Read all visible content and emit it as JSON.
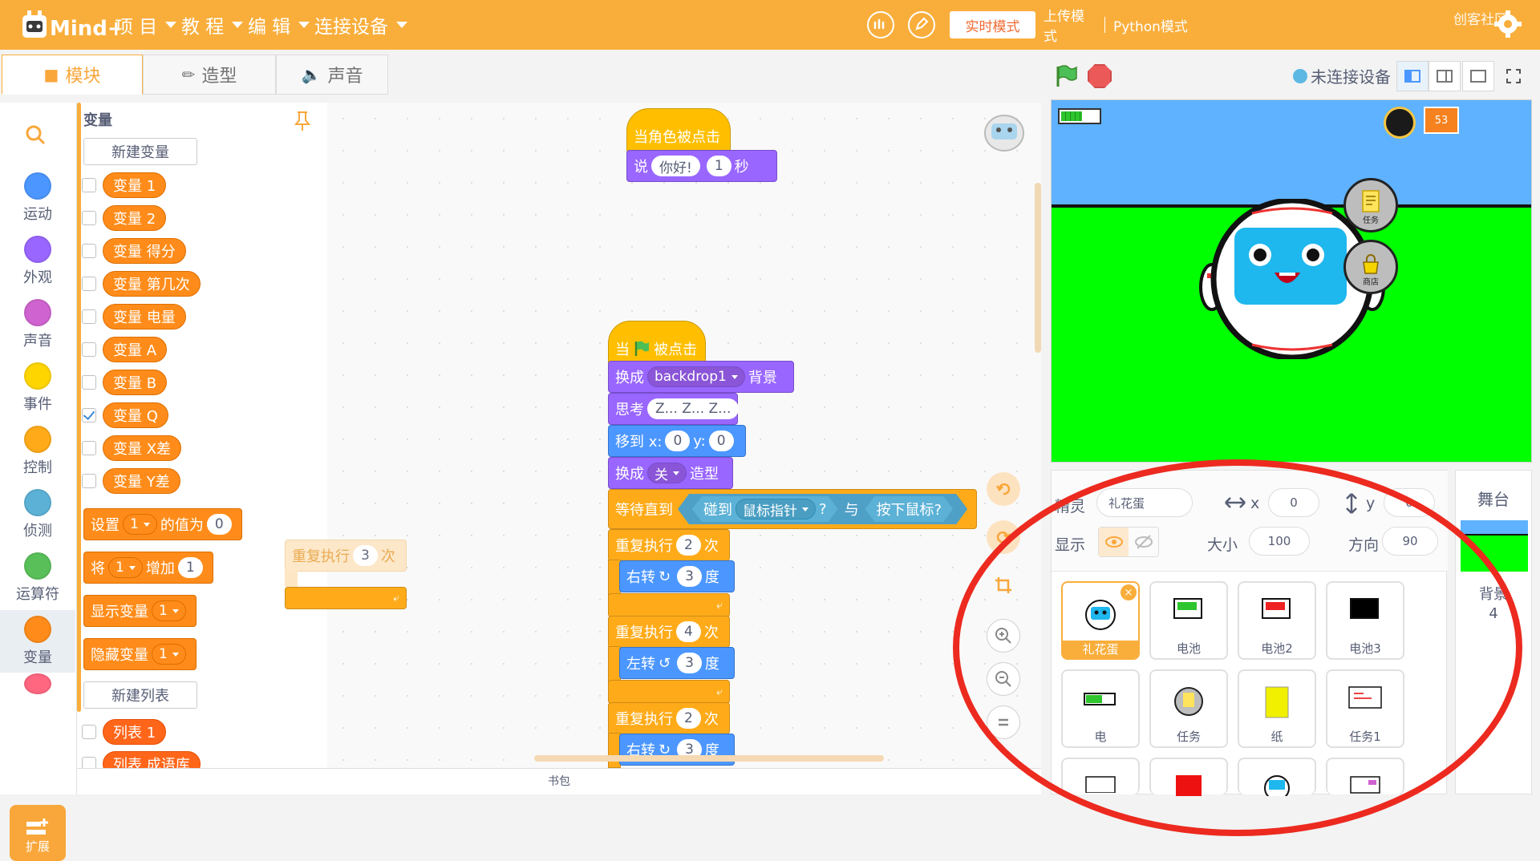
{
  "app": {
    "logo_text": "Mind+"
  },
  "menu": {
    "items": [
      {
        "label": "项 目"
      },
      {
        "label": "教 程"
      },
      {
        "label": "编 辑"
      },
      {
        "label": "连接设备"
      }
    ]
  },
  "modes": {
    "realtime": "实时模式",
    "upload": "上传模式",
    "python": "Python模式"
  },
  "brand_tag": "创客社区",
  "tabs": {
    "blocks": "模块",
    "costumes": "造型",
    "sounds": "声音"
  },
  "connection": {
    "status": "未连接设备"
  },
  "categories": [
    {
      "label": "运动",
      "color": "#4c97ff"
    },
    {
      "label": "外观",
      "color": "#9966ff"
    },
    {
      "label": "声音",
      "color": "#cf63cf"
    },
    {
      "label": "事件",
      "color": "#ffd500"
    },
    {
      "label": "控制",
      "color": "#ffab19"
    },
    {
      "label": "侦测",
      "color": "#5cb1d6"
    },
    {
      "label": "运算符",
      "color": "#59c059"
    },
    {
      "label": "变量",
      "color": "#ff8c1a"
    }
  ],
  "extension_label": "扩展",
  "palette": {
    "title": "变量",
    "new_variable": "新建变量",
    "variables": [
      {
        "name": "变量 1",
        "checked": false
      },
      {
        "name": "变量 2",
        "checked": false
      },
      {
        "name": "变量 得分",
        "checked": false
      },
      {
        "name": "变量 第几次",
        "checked": false
      },
      {
        "name": "变量 电量",
        "checked": false
      },
      {
        "name": "变量 A",
        "checked": false
      },
      {
        "name": "变量 B",
        "checked": false
      },
      {
        "name": "变量 Q",
        "checked": true
      },
      {
        "name": "变量 X差",
        "checked": false
      },
      {
        "name": "变量 Y差",
        "checked": false
      }
    ],
    "set_block": {
      "prefix": "设置",
      "dropdown": "1",
      "mid": "的值为",
      "value": "0"
    },
    "change_block": {
      "prefix": "将",
      "dropdown": "1",
      "mid": "增加",
      "value": "1"
    },
    "show_block": {
      "prefix": "显示变量",
      "dropdown": "1"
    },
    "hide_block": {
      "prefix": "隐藏变量",
      "dropdown": "1"
    },
    "new_list": "新建列表",
    "lists": [
      {
        "name": "列表 1"
      },
      {
        "name": "列表 成语库"
      }
    ]
  },
  "script": {
    "script1": {
      "hat": "当角色被点击",
      "say": {
        "prefix": "说",
        "text": "你好!",
        "secs": "1",
        "suffix": "秒"
      }
    },
    "floating_repeat": {
      "prefix": "重复执行",
      "count": "3",
      "suffix": "次"
    },
    "script2": {
      "hat_prefix": "当",
      "hat_suffix": "被点击",
      "switch_backdrop": {
        "prefix": "换成",
        "value": "backdrop1",
        "suffix": "背景"
      },
      "think": {
        "prefix": "思考",
        "text": "Z... Z... Z..."
      },
      "goto": {
        "prefix": "移到 x:",
        "x": "0",
        "ylabel": "y:",
        "y": "0"
      },
      "switch_costume": {
        "prefix": "换成",
        "value": "关",
        "suffix": "造型"
      },
      "wait_until": {
        "prefix": "等待直到",
        "touch": "碰到",
        "target": "鼠标指针",
        "q": "?",
        "and": "与",
        "mouse": "按下鼠标?"
      },
      "repeat1": {
        "prefix": "重复执行",
        "count": "2",
        "suffix": "次"
      },
      "turn_right": {
        "prefix": "右转",
        "deg": "3",
        "suffix": "度"
      },
      "repeat2": {
        "prefix": "重复执行",
        "count": "4",
        "suffix": "次"
      },
      "turn_left": {
        "prefix": "左转",
        "deg": "3",
        "suffix": "度"
      },
      "repeat3": {
        "prefix": "重复执行",
        "count": "2",
        "suffix": "次"
      },
      "turn_right2": {
        "prefix": "右转",
        "deg": "3",
        "suffix": "度"
      }
    }
  },
  "backpack": "书包",
  "stage": {
    "score": "53",
    "task_btn": "任务",
    "shop_btn": "商店"
  },
  "sprite_info": {
    "sprite_label": "精灵",
    "sprite_name": "礼花蛋",
    "x_label": "x",
    "x_value": "0",
    "y_label": "y",
    "y_value": "0",
    "show_label": "显示",
    "size_label": "大小",
    "size_value": "100",
    "direction_label": "方向",
    "direction_value": "90"
  },
  "sprites": [
    {
      "name": "礼花蛋",
      "selected": true
    },
    {
      "name": "电池"
    },
    {
      "name": "电池2"
    },
    {
      "name": "电池3"
    },
    {
      "name": "电"
    },
    {
      "name": "任务"
    },
    {
      "name": "纸"
    },
    {
      "name": "任务1"
    }
  ],
  "stage_panel": {
    "title": "舞台",
    "backdrops_label": "背景",
    "backdrops_count": "4"
  }
}
